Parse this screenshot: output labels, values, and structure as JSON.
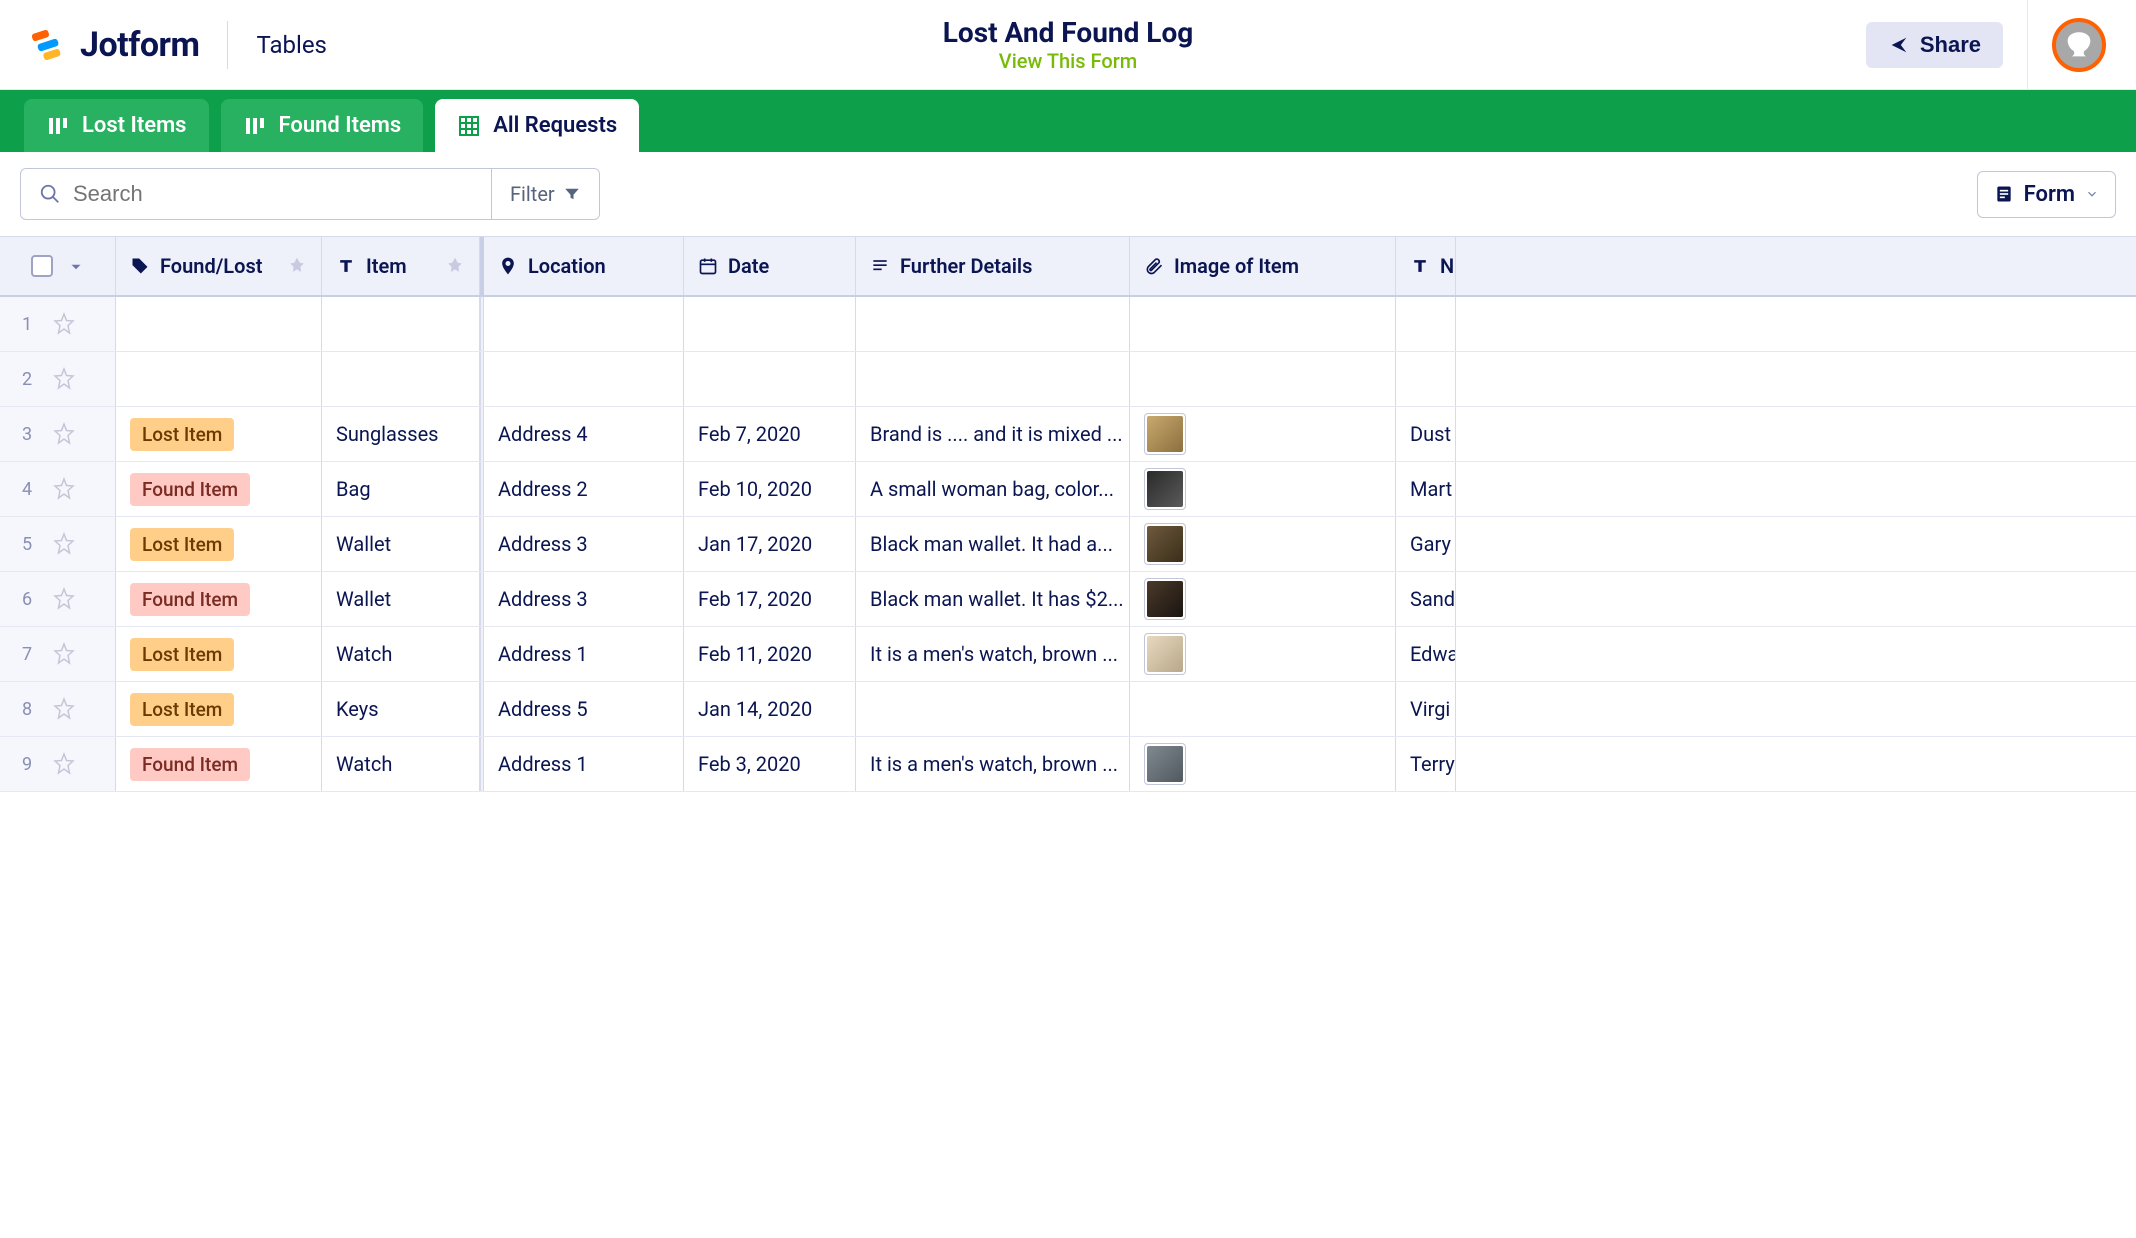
{
  "header": {
    "logo_text": "Jotform",
    "tables_label": "Tables",
    "title": "Lost And Found Log",
    "view_form": "View This Form",
    "share_label": "Share"
  },
  "tabs": {
    "lost": "Lost Items",
    "found": "Found Items",
    "all": "All Requests"
  },
  "toolbar": {
    "search_placeholder": "Search",
    "filter_label": "Filter",
    "form_label": "Form"
  },
  "columns": {
    "status": "Found/Lost",
    "item": "Item",
    "location": "Location",
    "date": "Date",
    "details": "Further Details",
    "image": "Image of Item",
    "name": "N"
  },
  "badges": {
    "lost": "Lost Item",
    "found": "Found Item"
  },
  "rows": [
    {
      "idx": "1",
      "status": "",
      "item": "",
      "location": "",
      "date": "",
      "details": "",
      "thumb": "",
      "name": ""
    },
    {
      "idx": "2",
      "status": "",
      "item": "",
      "location": "",
      "date": "",
      "details": "",
      "thumb": "",
      "name": ""
    },
    {
      "idx": "3",
      "status": "lost",
      "item": "Sunglasses",
      "location": "Address 4",
      "date": "Feb 7, 2020",
      "details": "Brand is .... and it is mixed ...",
      "thumb": "t1",
      "name": "Dust"
    },
    {
      "idx": "4",
      "status": "found",
      "item": "Bag",
      "location": "Address 2",
      "date": "Feb 10, 2020",
      "details": "A small woman bag, color...",
      "thumb": "t2",
      "name": "Mart"
    },
    {
      "idx": "5",
      "status": "lost",
      "item": "Wallet",
      "location": "Address 3",
      "date": "Jan 17, 2020",
      "details": "Black man wallet. It had a...",
      "thumb": "t3",
      "name": "Gary"
    },
    {
      "idx": "6",
      "status": "found",
      "item": "Wallet",
      "location": "Address 3",
      "date": "Feb 17, 2020",
      "details": "Black man wallet. It has $2...",
      "thumb": "t4",
      "name": "Sand"
    },
    {
      "idx": "7",
      "status": "lost",
      "item": "Watch",
      "location": "Address 1",
      "date": "Feb 11, 2020",
      "details": "It is a men's watch, brown ...",
      "thumb": "t5",
      "name": "Edwa"
    },
    {
      "idx": "8",
      "status": "lost",
      "item": "Keys",
      "location": "Address 5",
      "date": "Jan 14, 2020",
      "details": "",
      "thumb": "",
      "name": "Virgi"
    },
    {
      "idx": "9",
      "status": "found",
      "item": "Watch",
      "location": "Address 1",
      "date": "Feb 3, 2020",
      "details": "It is a men's watch, brown ...",
      "thumb": "t6",
      "name": "Terry"
    }
  ]
}
